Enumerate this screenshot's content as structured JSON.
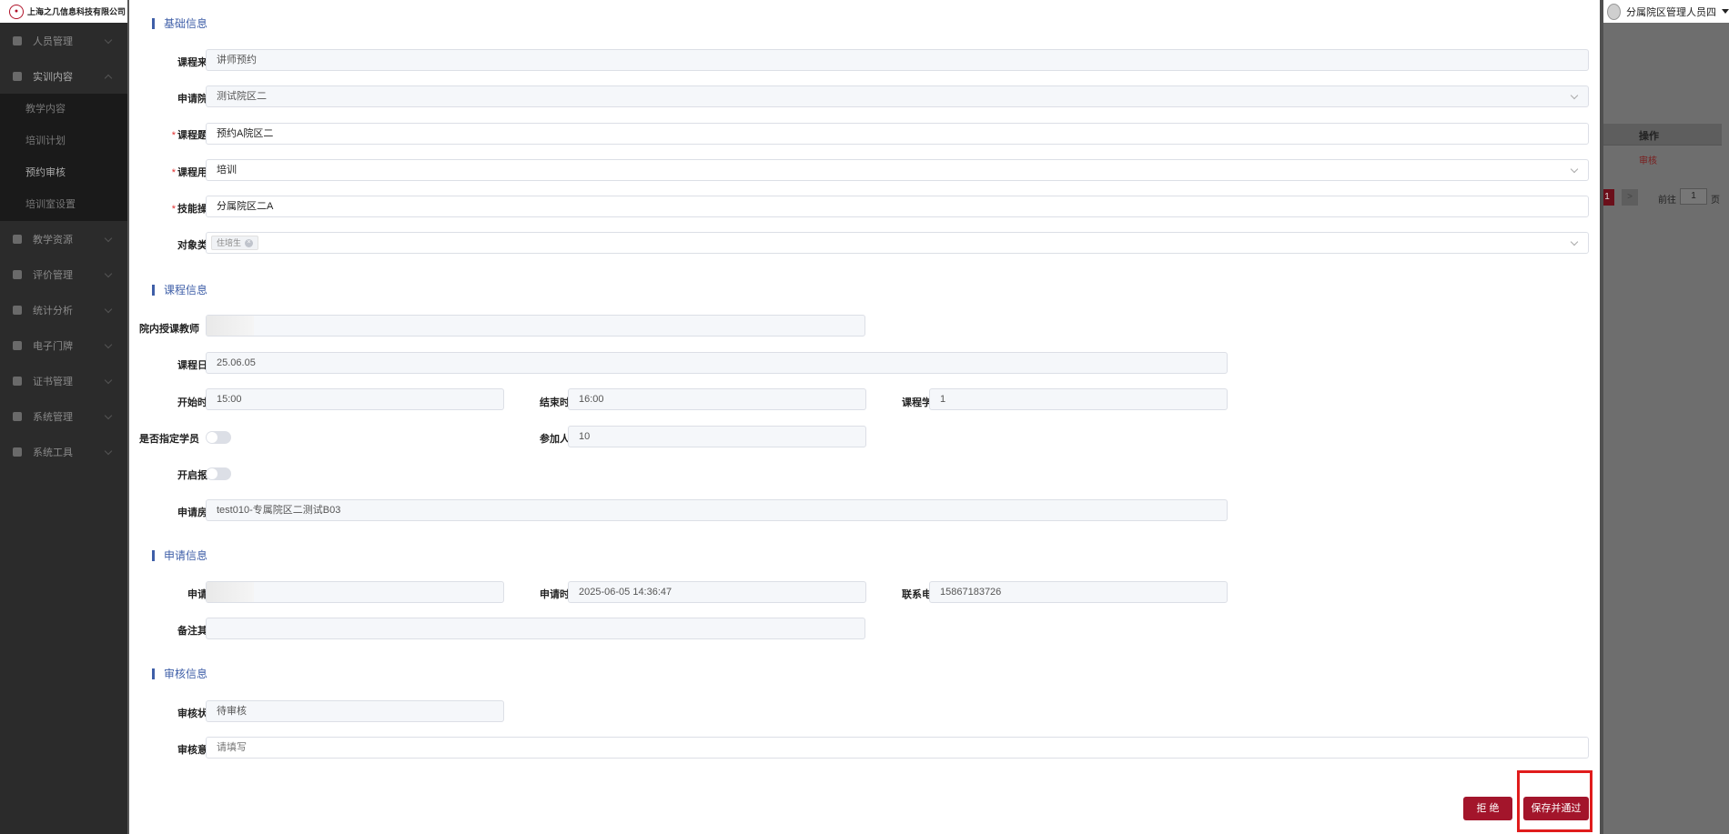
{
  "company": "上海之几信息科技有限公司",
  "user": {
    "name": "分属院区管理人员四"
  },
  "sidebar": {
    "items": [
      {
        "label": "人员管理"
      },
      {
        "label": "实训内容"
      },
      {
        "label": "教学资源"
      },
      {
        "label": "评价管理"
      },
      {
        "label": "统计分析"
      },
      {
        "label": "电子门牌"
      },
      {
        "label": "证书管理"
      },
      {
        "label": "系统管理"
      },
      {
        "label": "系统工具"
      }
    ],
    "subitems": [
      {
        "label": "教学内容"
      },
      {
        "label": "培训计划"
      },
      {
        "label": "预约审核"
      },
      {
        "label": "培训室设置"
      }
    ]
  },
  "background": {
    "op_header": "操作",
    "op_link": "审核",
    "page_current": "1",
    "page_next": ">",
    "goto_label": "前往",
    "goto_value": "1",
    "page_unit": "页"
  },
  "form": {
    "sections": {
      "basic": "基础信息",
      "course": "课程信息",
      "apply": "申请信息",
      "review": "审核信息"
    },
    "labels": {
      "source": "课程来源",
      "campus": "申请院区",
      "topic": "课程题目",
      "usage": "课程用途",
      "skill": "技能操作",
      "target": "对象类型",
      "teacher": "院内授课教师",
      "date": "课程日期",
      "start": "开始时间",
      "end": "结束时间",
      "hours": "课程学时",
      "assign": "是否指定学员",
      "count": "参加人数",
      "signup": "开启报名",
      "room": "申请房间",
      "applicant": "申请人",
      "apply_time": "申请时间",
      "phone": "联系电话",
      "remark": "备注其他",
      "status": "审核状态",
      "opinion": "审核意见"
    },
    "values": {
      "source": "讲师预约",
      "campus": "测试院区二",
      "topic": "预约A院区二",
      "usage": "培训",
      "skill": "分属院区二A",
      "target_tag": "住培生",
      "teacher": "",
      "date": "25.06.05",
      "start": "15:00",
      "end": "16:00",
      "hours": "1",
      "count": "10",
      "room": "test010-专属院区二测试B03",
      "applicant": "",
      "apply_time": "2025-06-05 14:36:47",
      "phone": "15867183726",
      "remark": "",
      "status": "待审核",
      "opinion_placeholder": "请填写"
    },
    "buttons": {
      "reject": "拒 绝",
      "approve": "保存并通过"
    }
  }
}
